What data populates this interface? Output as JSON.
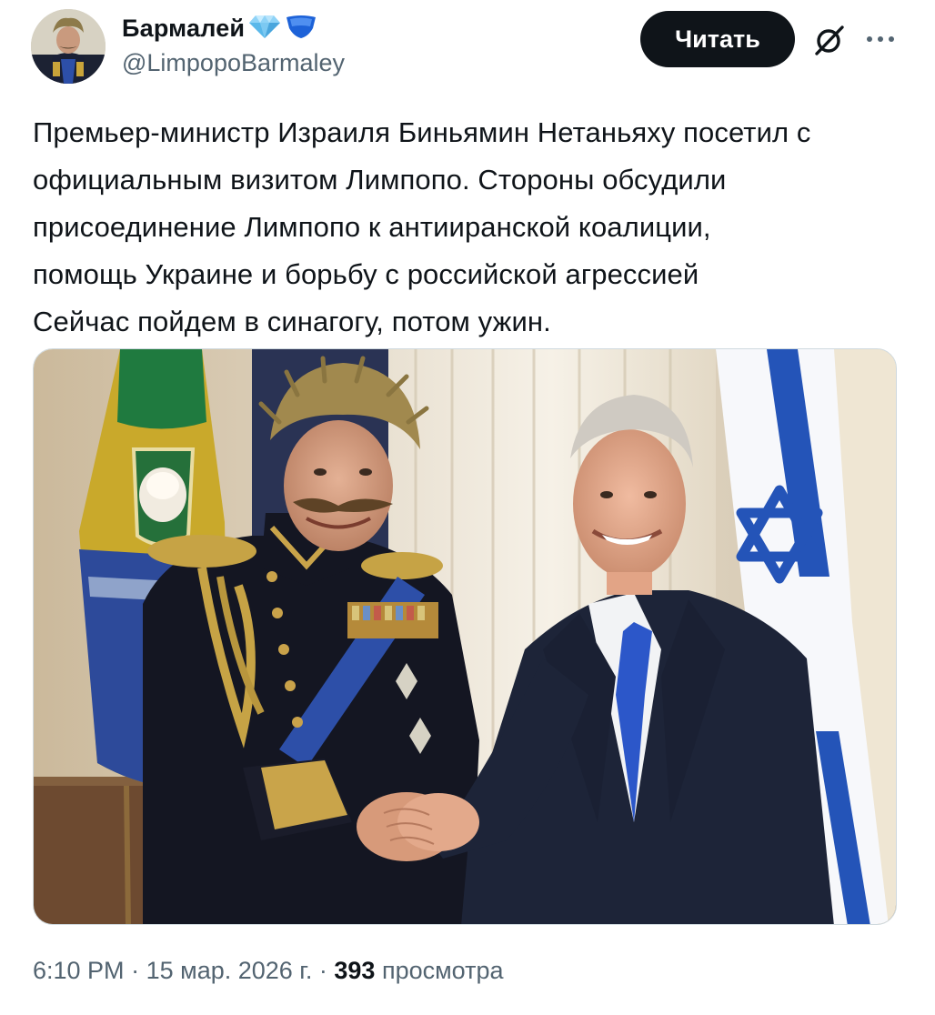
{
  "author": {
    "display_name": "Бармалей",
    "handle": "@LimpopoBarmaley",
    "badges": [
      "diamond-icon",
      "shield-badge-icon"
    ]
  },
  "actions": {
    "follow_label": "Читать",
    "grok_icon": "grok-icon",
    "more_icon": "more-icon"
  },
  "tweet": {
    "lines": [
      "Премьер-министр Израиля Биньямин Нетаньяху посетил с",
      "официальным визитом Лимпопо. Стороны обсудили",
      "присоединение Лимпопо к антииранской коалиции,",
      "помощь Украине и борьбу с российской агрессией",
      "Сейчас пойдем в синагогу, потом ужин."
    ]
  },
  "meta": {
    "time": "6:10 PM",
    "separator": "·",
    "date": "15 мар. 2026 г.",
    "views_count": "393",
    "views_label": "просмотра"
  },
  "colors": {
    "text": "#0f1419",
    "secondary": "#536471",
    "button_bg": "#0f1419",
    "badge_blue": "#1d9bf0",
    "israel_blue": "#1f4fb8"
  }
}
